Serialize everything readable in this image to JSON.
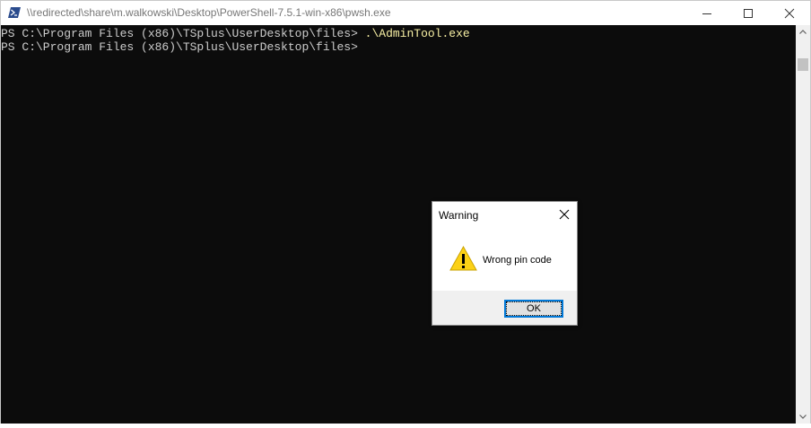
{
  "window": {
    "title": "\\\\redirected\\share\\m.walkowski\\Desktop\\PowerShell-7.5.1-win-x86\\pwsh.exe",
    "app_icon": "powershell-icon",
    "controls": [
      "minimize-icon",
      "maximize-icon",
      "close-icon"
    ]
  },
  "console": {
    "lines": [
      {
        "prompt": "PS C:\\Program Files (x86)\\TSplus\\UserDesktop\\files> ",
        "command": ".\\AdminTool.exe"
      },
      {
        "prompt": "PS C:\\Program Files (x86)\\TSplus\\UserDesktop\\files>",
        "command": ""
      }
    ],
    "colors": {
      "background": "#0c0c0c",
      "text": "#cccccc",
      "command": "#f9f1a5"
    }
  },
  "dialog": {
    "title": "Warning",
    "icon": "warning-icon",
    "message": "Wrong pin code",
    "ok_label": "OK",
    "colors": {
      "accent": "#0078d7",
      "warning": "#fcd116"
    }
  }
}
